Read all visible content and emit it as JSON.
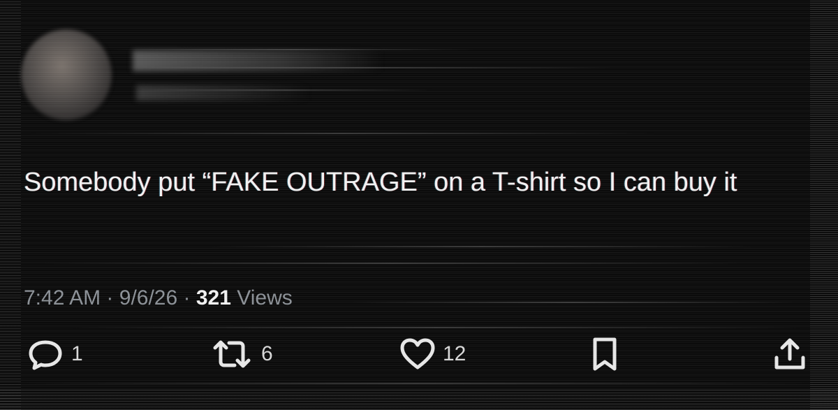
{
  "tweet": {
    "text": "Somebody put “FAKE OUTRAGE” on a T-shirt so I can buy it",
    "time": "7:42 AM",
    "separator": "·",
    "date": "9/6/26",
    "views_count": "321",
    "views_label": "Views"
  },
  "actions": {
    "reply_count": "1",
    "repost_count": "6",
    "like_count": "12"
  },
  "icons": {
    "reply": "reply-icon",
    "repost": "repost-icon",
    "like": "heart-icon",
    "bookmark": "bookmark-icon",
    "share": "share-icon"
  },
  "colors": {
    "background": "#0b0b0b",
    "text": "#f1f1f1",
    "meta": "#8b9096"
  }
}
